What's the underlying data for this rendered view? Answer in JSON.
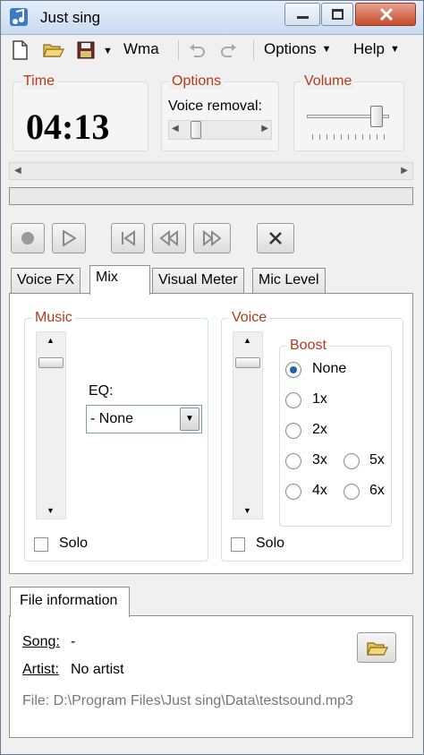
{
  "window": {
    "title": "Just sing"
  },
  "menubar": {
    "format_label": "Wma",
    "options_label": "Options",
    "help_label": "Help"
  },
  "time": {
    "title": "Time",
    "value": "04:13"
  },
  "options": {
    "title": "Options",
    "voice_removal_label": "Voice removal:"
  },
  "volume": {
    "title": "Volume",
    "level": 0.85
  },
  "tabs": [
    {
      "label": "Voice FX"
    },
    {
      "label": "Mix"
    },
    {
      "label": "Visual Meter"
    },
    {
      "label": "Mic Level"
    }
  ],
  "mix": {
    "music": {
      "title": "Music",
      "solo_label": "Solo"
    },
    "eq": {
      "label": "EQ:",
      "selected": "- None"
    },
    "voice": {
      "title": "Voice",
      "solo_label": "Solo"
    },
    "boost": {
      "title": "Boost",
      "options": [
        "None",
        "1x",
        "2x",
        "3x",
        "4x",
        "5x",
        "6x"
      ],
      "selected": "None"
    }
  },
  "file_info": {
    "tab_label": "File information",
    "song_label": "Song:",
    "song_value": "-",
    "artist_label": "Artist:",
    "artist_value": "No artist",
    "file_line": "File: D:\\Program Files\\Just sing\\Data\\testsound.mp3"
  },
  "colors": {
    "group_title": "#b33a1a",
    "accent": "#2b5ea8"
  }
}
